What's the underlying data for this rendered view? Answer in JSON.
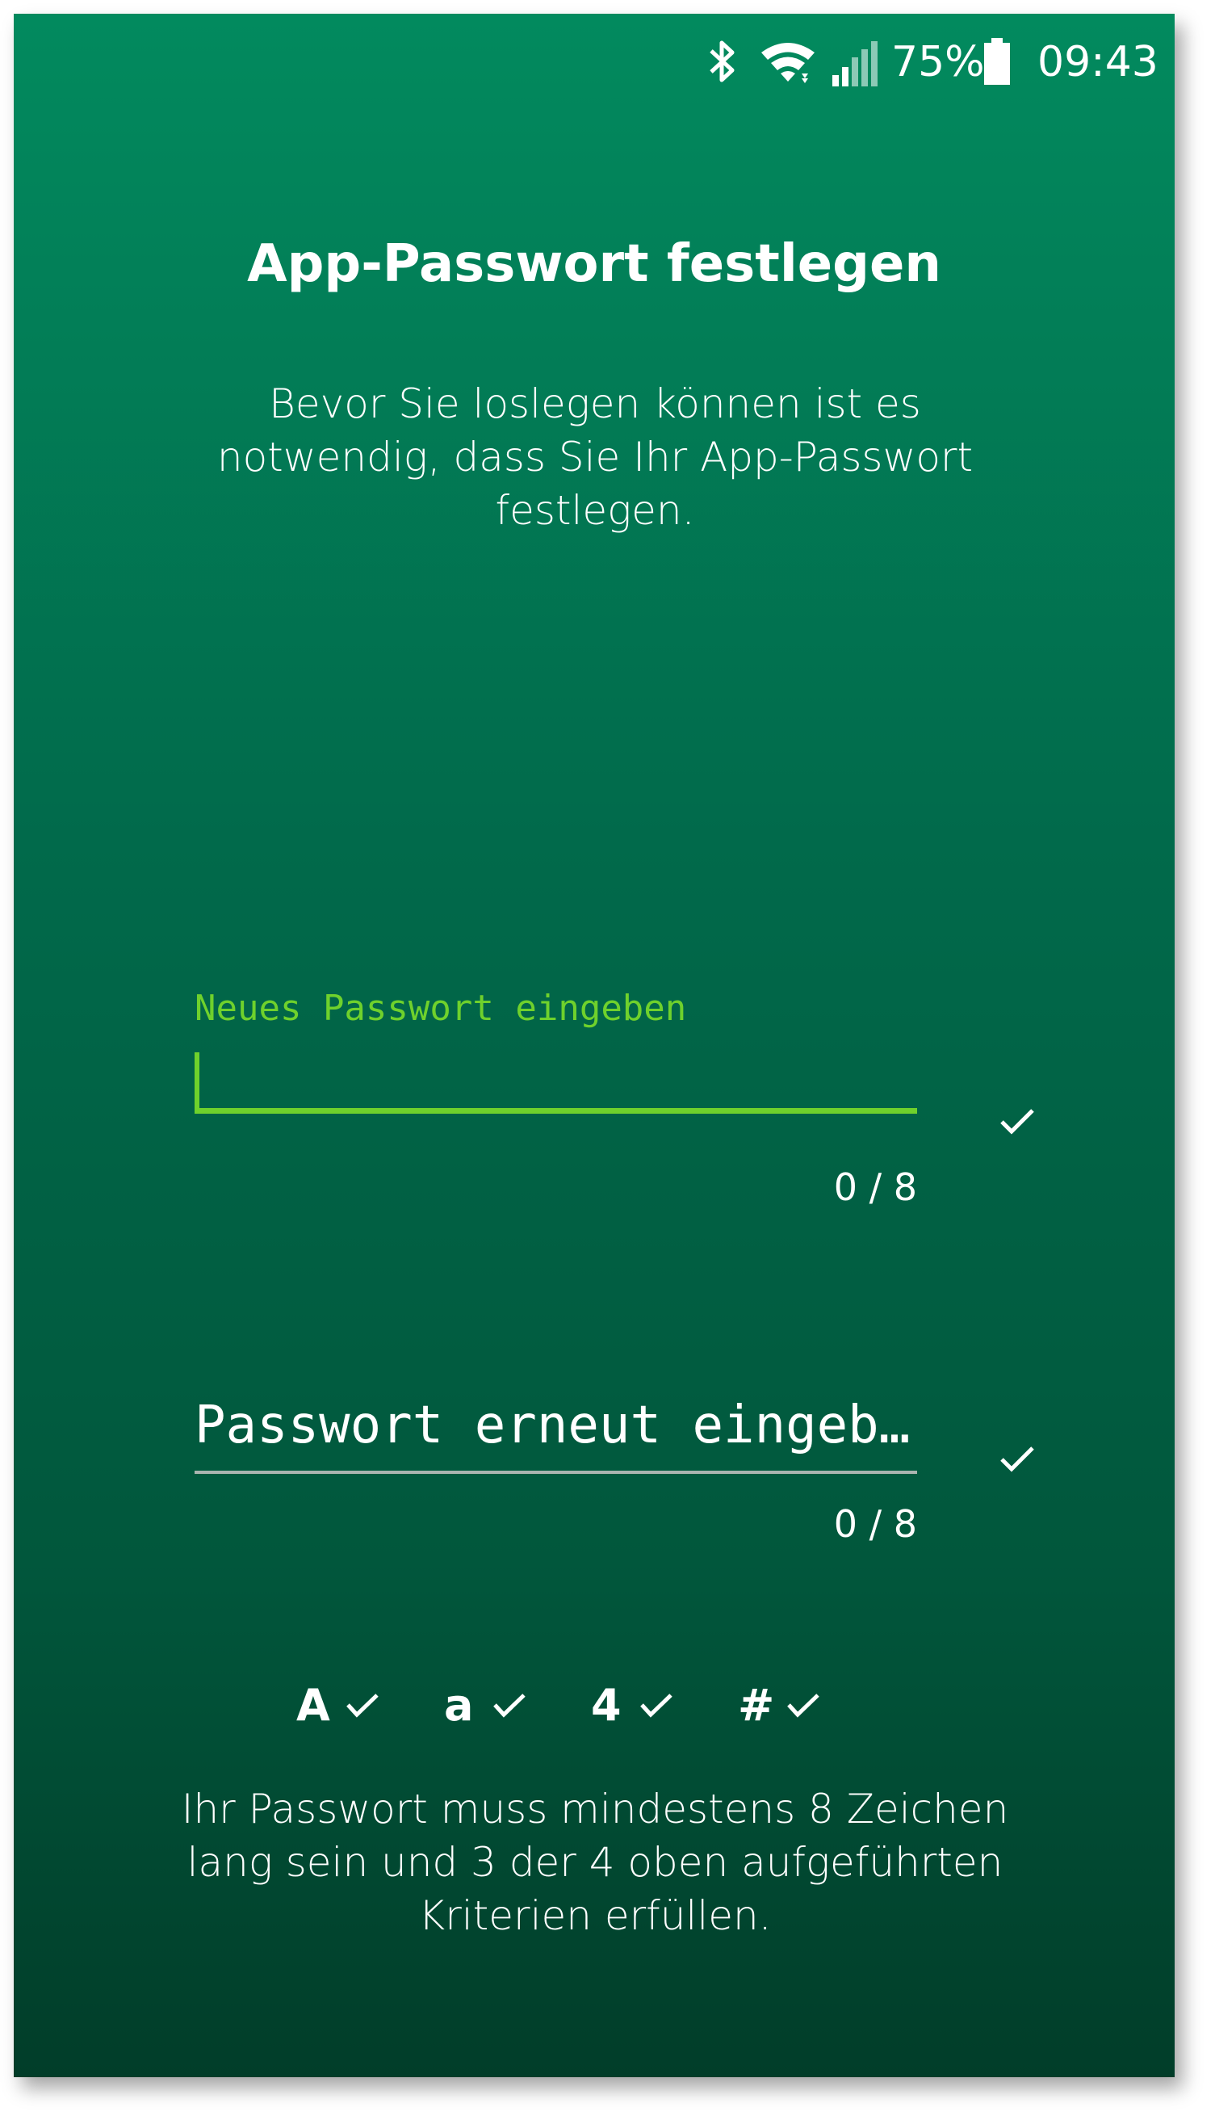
{
  "status_bar": {
    "battery_percent": "75%",
    "time": "09:43",
    "icons": [
      "bluetooth-icon",
      "wifi-icon",
      "signal-icon",
      "battery-icon"
    ]
  },
  "screen": {
    "title": "App-Passwort festlegen",
    "intro": "Bevor Sie loslegen können ist es notwendig, dass Sie Ihr App-Passwort festlegen."
  },
  "new_password": {
    "label": "Neues Passwort eingeben",
    "value": "",
    "counter": "0 / 8"
  },
  "confirm_password": {
    "placeholder": "Passwort erneut eingeb…",
    "counter": "0 / 8"
  },
  "criteria": [
    {
      "char": "A"
    },
    {
      "char": "a"
    },
    {
      "char": "4"
    },
    {
      "char": "#"
    }
  ],
  "footer": {
    "text": "Ihr Passwort muss mindestens 8 Zeichen lang sein und 3 der 4 oben aufgeführten Kriterien erfüllen."
  },
  "colors": {
    "background_top": "#028a5e",
    "background_bottom": "#013d29",
    "accent": "#6fd12c",
    "text": "#ffffff"
  }
}
